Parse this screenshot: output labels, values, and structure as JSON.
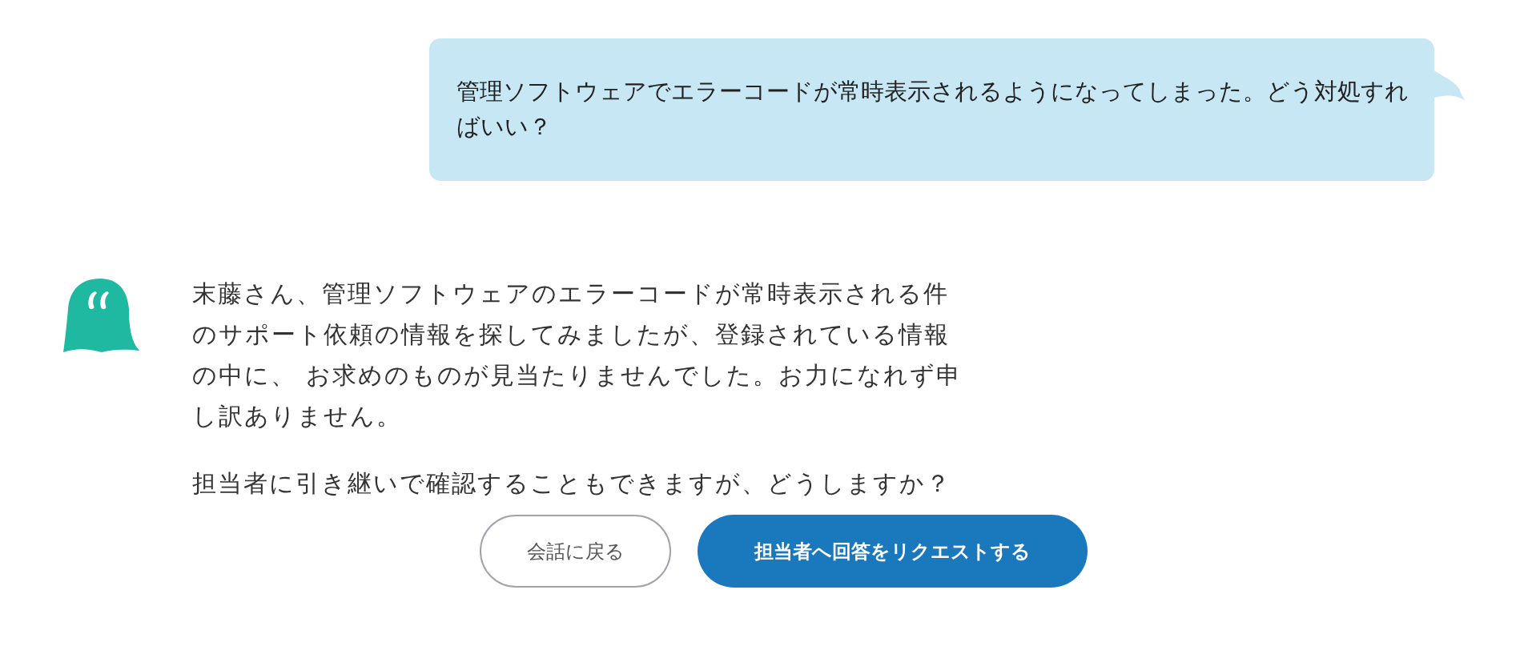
{
  "user_message": {
    "text": "管理ソフトウェアでエラーコードが常時表示されるようになってしまった。どう対処すればいい？"
  },
  "bot_message": {
    "paragraphs": [
      "末藤さん、管理ソフトウェアのエラーコードが常時表示される件のサポート依頼の情報を探してみましたが、登録されている情報の中に、 お求めのものが見当たりませんでした。お力になれず申し訳ありません。",
      "担当者に引き継いで確認することもできますが、どうしますか？"
    ]
  },
  "actions": [
    {
      "label": "会話に戻る",
      "kind": "secondary"
    },
    {
      "label": "担当者へ回答をリクエストする",
      "kind": "primary"
    }
  ]
}
